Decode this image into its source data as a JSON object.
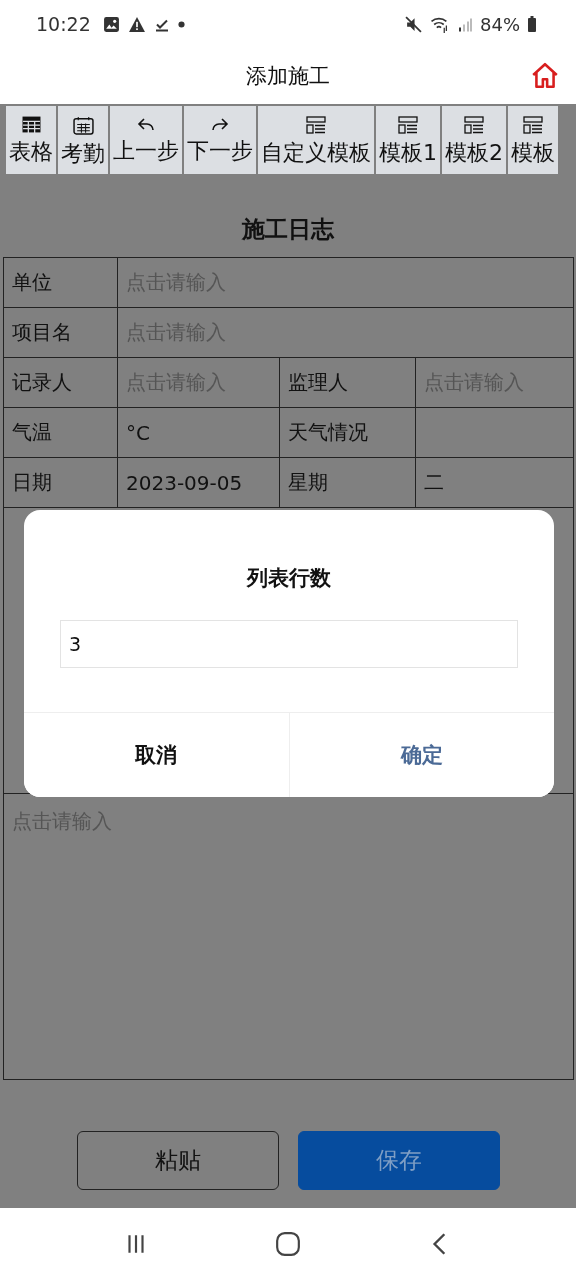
{
  "status_bar": {
    "time": "10:22",
    "battery": "84%"
  },
  "header": {
    "title": "添加施工"
  },
  "toolbar": [
    {
      "kind": "table",
      "label": "表格"
    },
    {
      "kind": "calendar",
      "label": "考勤"
    },
    {
      "kind": "undo",
      "label": "上一步"
    },
    {
      "kind": "redo",
      "label": "下一步"
    },
    {
      "kind": "template",
      "label": "自定义模板"
    },
    {
      "kind": "template",
      "label": "模板1"
    },
    {
      "kind": "template",
      "label": "模板2"
    },
    {
      "kind": "template",
      "label": "模板"
    }
  ],
  "form": {
    "title": "施工日志",
    "rows": [
      [
        {
          "kind": "label",
          "text": "单位"
        },
        {
          "kind": "placeholder",
          "text": "点击请输入"
        }
      ],
      [
        {
          "kind": "label",
          "text": "项目名"
        },
        {
          "kind": "placeholder",
          "text": "点击请输入"
        }
      ],
      [
        {
          "kind": "label",
          "text": "记录人"
        },
        {
          "kind": "placeholder",
          "text": "点击请输入"
        },
        {
          "kind": "label",
          "text": "监理人"
        },
        {
          "kind": "placeholder",
          "text": "点击请输入"
        }
      ],
      [
        {
          "kind": "label",
          "text": "气温"
        },
        {
          "kind": "value",
          "text": "°C"
        },
        {
          "kind": "label",
          "text": "天气情况"
        },
        {
          "kind": "value"
        }
      ],
      [
        {
          "kind": "label",
          "text": "日期"
        },
        {
          "kind": "value",
          "text": "2023-09-05"
        },
        {
          "kind": "label",
          "text": "星期"
        },
        {
          "kind": "value",
          "text": "二"
        }
      ]
    ],
    "notes": [
      {
        "placeholder": "点击请输入"
      }
    ]
  },
  "dialog": {
    "title": "列表行数",
    "value": "3",
    "buttons": [
      {
        "kind": "cancel",
        "label": "取消"
      },
      {
        "kind": "confirm",
        "label": "确定"
      }
    ]
  },
  "actions": [
    {
      "kind": "outline",
      "label": "粘贴"
    },
    {
      "kind": "primary",
      "label": "保存"
    }
  ]
}
